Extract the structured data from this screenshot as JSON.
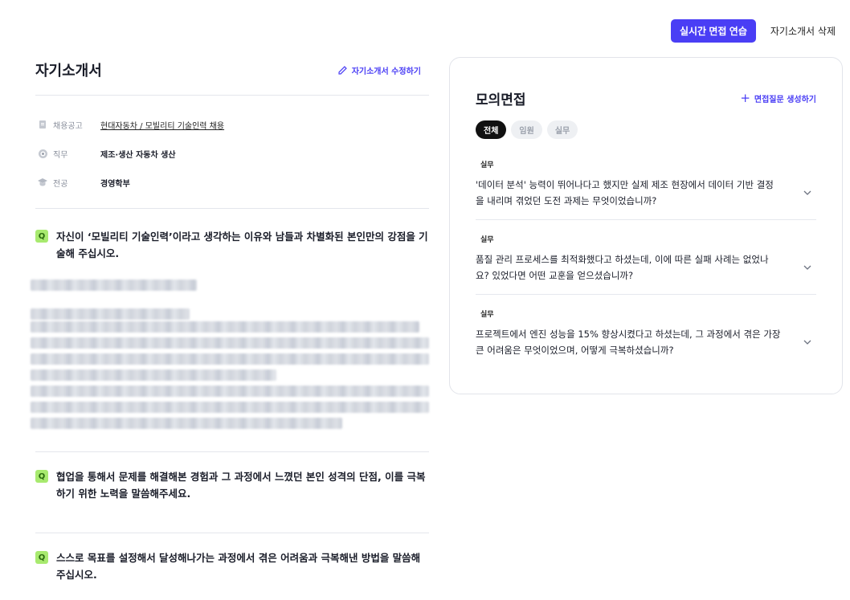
{
  "topbar": {
    "practice_button": "실시간 면접 연습",
    "delete_button": "자기소개서 삭제"
  },
  "left": {
    "title": "자기소개서",
    "edit_label": "자기소개서 수정하기",
    "meta": [
      {
        "label": "채용공고",
        "value": "현대자동차 / 모빌리티 기술인력 채용",
        "icon": "document-icon"
      },
      {
        "label": "직무",
        "value": "제조·생산 자동차 생산",
        "icon": "target-icon"
      },
      {
        "label": "전공",
        "value": "경영학부",
        "icon": "graduation-cap-icon"
      }
    ],
    "q_badge": "Q",
    "questions": [
      {
        "text": "자신이 ‘모빌리티 기술인력’이라고 생각하는 이유와 남들과 차별화된 본인만의 강점을 기술해 주십시오."
      },
      {
        "text": "협업을 통해서 문제를 해결해본 경험과 그 과정에서 느꼈던 본인 성격의 단점, 이를 극복하기 위한 노력을 말씀해주세요."
      },
      {
        "text": "스스로 목표를 설정해서 달성해나가는 과정에서 겪은 어려움과 극복해낸 방법을 말씀해 주십시오."
      }
    ]
  },
  "right": {
    "title": "모의면접",
    "generate_label": "면접질문 생성하기",
    "tabs": [
      "전체",
      "임원",
      "실무"
    ],
    "items": [
      {
        "tag": "실무",
        "text": "'데이터 분석' 능력이 뛰어나다고 했지만 실제 제조 현장에서 데이터 기반 결정을 내리며 겪었던 도전 과제는 무엇이었습니까?"
      },
      {
        "tag": "실무",
        "text": "품질 관리 프로세스를 최적화했다고 하셨는데, 이에 따른 실패 사례는 없었나요? 있었다면 어떤 교훈을 얻으셨습니까?"
      },
      {
        "tag": "실무",
        "text": "프로젝트에서 엔진 성능을 15% 향상시켰다고 하셨는데, 그 과정에서 겪은 가장 큰 어려움은 무엇이었으며, 어떻게 극복하셨습니까?"
      }
    ]
  },
  "colors": {
    "accent": "#4a3ef5",
    "q_badge_bg": "#a8ea6f"
  }
}
